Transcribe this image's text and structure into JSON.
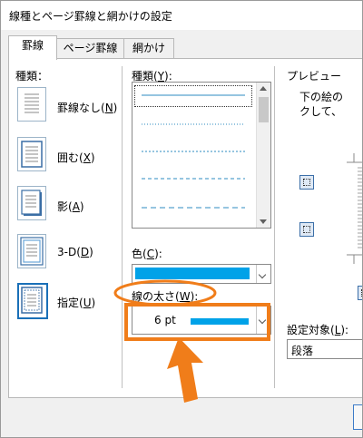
{
  "window": {
    "title": "線種とページ罫線と網かけの設定"
  },
  "tabs": [
    {
      "label": "罫線",
      "active": true
    },
    {
      "label": "ページ罫線",
      "active": false
    },
    {
      "label": "網かけ",
      "active": false
    }
  ],
  "setting": {
    "header": "種類：",
    "options": [
      {
        "label": "罫線なし(",
        "key": "N",
        "suffix": ")",
        "icon": "no-border-icon"
      },
      {
        "label": "囲む(",
        "key": "X",
        "suffix": ")",
        "icon": "box-border-icon"
      },
      {
        "label": "影(",
        "key": "A",
        "suffix": ")",
        "icon": "shadow-border-icon"
      },
      {
        "label": "3-D(",
        "key": "D",
        "suffix": ")",
        "icon": "3d-border-icon"
      },
      {
        "label": "指定(",
        "key": "U",
        "suffix": ")",
        "icon": "custom-border-icon",
        "selected": true
      }
    ]
  },
  "style": {
    "label": "種類(",
    "key": "Y",
    "suffix": "):"
  },
  "color": {
    "label": "色(",
    "key": "C",
    "suffix": "):",
    "value_color": "#00a2e8"
  },
  "width": {
    "label": "線の太さ(",
    "key": "W",
    "suffix": "):",
    "value": "6 pt"
  },
  "preview": {
    "header": "プレビュー",
    "text_line1": "下の絵の",
    "text_line2": "クして、"
  },
  "apply_to": {
    "label": "設定対象(",
    "key": "L",
    "suffix": "):",
    "value": "段落"
  },
  "annotation": {
    "highlight_color": "#f07d1a"
  }
}
